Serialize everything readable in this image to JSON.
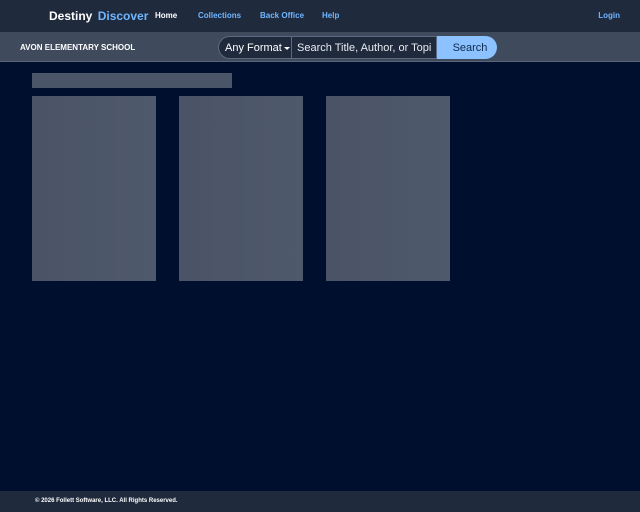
{
  "header": {
    "brand_primary": "Destiny",
    "brand_secondary": "Discover",
    "nav": [
      {
        "label": "Home"
      },
      {
        "label": "Collections"
      },
      {
        "label": "Back Office"
      },
      {
        "label": "Help"
      }
    ],
    "login_label": "Login"
  },
  "subheader": {
    "school_name": "AVON ELEMENTARY SCHOOL",
    "search": {
      "format_value": "Any Format",
      "placeholder": "Search Title, Author, or Topic",
      "button_label": "Search"
    }
  },
  "footer": {
    "copyright": "© 2026 Follett Software, LLC. All Rights Reserved."
  },
  "colors": {
    "background": "#000f2e",
    "bar": "#1f2a3d",
    "accent": "#6fb6ff",
    "search_button": "#8bc2ff"
  }
}
